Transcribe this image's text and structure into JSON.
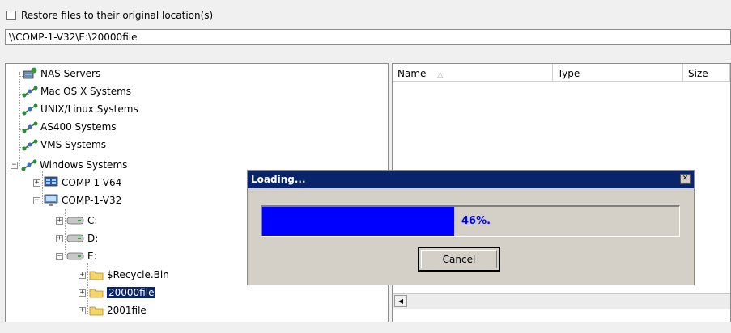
{
  "restore_checkbox": {
    "label": "Restore files to their original location(s)",
    "checked": false
  },
  "path": {
    "value": "\\\\COMP-1-V32\\E:\\20000file"
  },
  "tree": {
    "nas_servers": "NAS Servers",
    "mac_os": "Mac OS X Systems",
    "unix_linux": "UNIX/Linux Systems",
    "as400": "AS400 Systems",
    "vms": "VMS Systems",
    "windows": "Windows Systems",
    "comp_v64": "COMP-1-V64",
    "comp_v32": "COMP-1-V32",
    "drive_c": "C:",
    "drive_d": "D:",
    "drive_e": "E:",
    "recycle_bin": "$Recycle.Bin",
    "folder_20000": "20000file",
    "folder_2001": "2001file"
  },
  "list": {
    "columns": [
      "Name",
      "Type",
      "Size"
    ]
  },
  "dialog": {
    "title": "Loading...",
    "progress_text": "46%.",
    "progress_fraction": 0.46,
    "cancel_label": "Cancel"
  },
  "colors": {
    "title_bar": "#0a246a",
    "progress_fill": "#0000ff",
    "selection": "#0a246a"
  }
}
